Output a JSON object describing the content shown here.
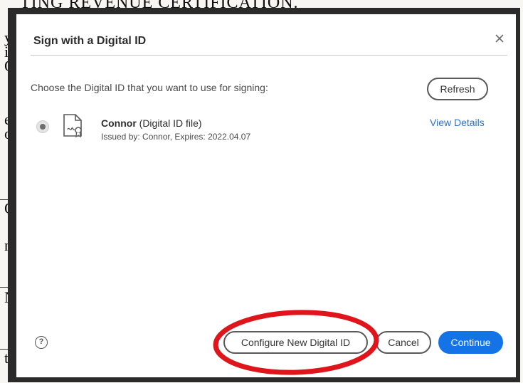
{
  "document": {
    "heading": "TING REVENUE CERTIFICATION.",
    "fragments": [
      "y",
      "iv",
      "O",
      "e",
      "os",
      "O",
      "ni",
      "N",
      "to"
    ]
  },
  "dialog": {
    "title": "Sign with a Digital ID",
    "close_icon": "close-icon",
    "prompt": "Choose the Digital ID that you want to use for signing:",
    "refresh_label": "Refresh",
    "digital_ids": [
      {
        "name": "Connor",
        "type": "(Digital ID file)",
        "issued": "Issued by: Connor, Expires: 2022.04.07",
        "selected": true,
        "icon": "certificate-file-icon",
        "details_label": "View Details"
      }
    ],
    "help_icon": "help-icon",
    "help_glyph": "?",
    "configure_label": "Configure New Digital ID",
    "cancel_label": "Cancel",
    "continue_label": "Continue"
  },
  "annotation": {
    "type": "red-ellipse",
    "target": "configure-new-digital-id-button",
    "color": "#e0151c"
  },
  "colors": {
    "accent": "#1473e6",
    "link": "#2d72c8",
    "annotation": "#e0151c"
  }
}
